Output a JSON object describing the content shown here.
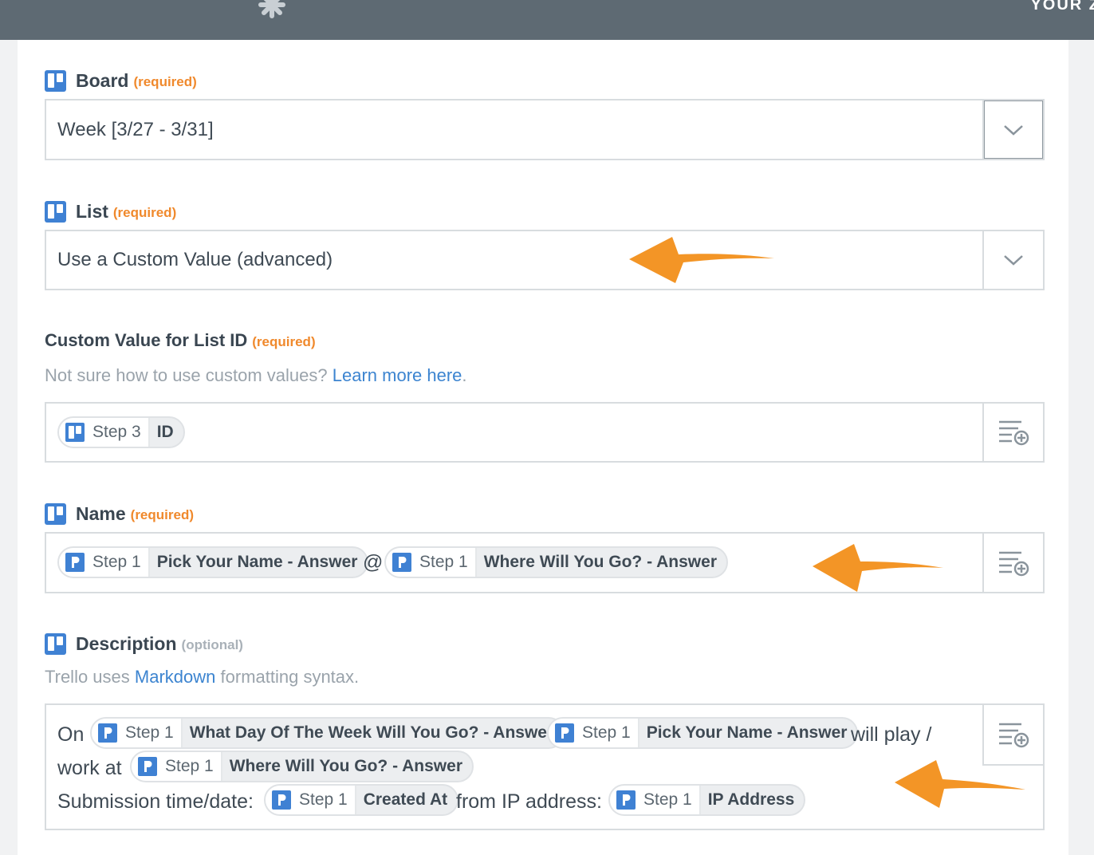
{
  "header": {
    "corner_text": "YOUR Z"
  },
  "fields": {
    "board": {
      "label": "Board",
      "tag": "(required)",
      "value": "Week [3/27 - 3/31]"
    },
    "list": {
      "label": "List",
      "tag": "(required)",
      "value": "Use a Custom Value (advanced)"
    },
    "custom": {
      "label": "Custom Value for List ID",
      "tag": "(required)",
      "help_text": "Not sure how to use custom values?",
      "help_link": "Learn more here",
      "help_end": ".",
      "pill": {
        "step": "Step 3",
        "value": "ID"
      }
    },
    "name": {
      "label": "Name",
      "tag": "(required)",
      "pill1": {
        "step": "Step 1",
        "value": "Pick Your Name - Answer"
      },
      "separator": "@",
      "pill2": {
        "step": "Step 1",
        "value": "Where Will You Go? - Answer"
      }
    },
    "description": {
      "label": "Description",
      "tag": "(optional)",
      "help_pre": "Trello uses",
      "help_link": "Markdown",
      "help_post": "formatting syntax.",
      "t_on": "On",
      "pill1": {
        "step": "Step 1",
        "value": "What Day Of The Week Will You Go? - Answer"
      },
      "pill2": {
        "step": "Step 1",
        "value": "Pick Your Name - Answer"
      },
      "t_will": "will play /",
      "t_work": "work at",
      "pill3": {
        "step": "Step 1",
        "value": "Where Will You Go? - Answer"
      },
      "t_sub": "Submission time/date:",
      "pill4": {
        "step": "Step 1",
        "value": "Created At"
      },
      "t_ip": "from IP address:",
      "pill5": {
        "step": "Step 1",
        "value": "IP Address"
      }
    }
  },
  "colors": {
    "required": "#f0892c",
    "link": "#3c84d0",
    "arrow": "#f39526",
    "trello": "#3f81d3"
  },
  "icons": [
    "trello-icon",
    "wufoo-p-icon",
    "chevron-down-icon",
    "insert-field-icon",
    "zapier-gear-icon",
    "arrow-annotation"
  ]
}
